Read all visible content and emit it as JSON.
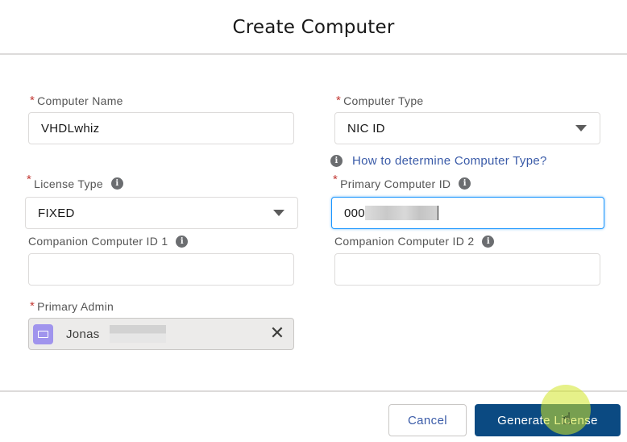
{
  "dialog": {
    "title": "Create Computer"
  },
  "form": {
    "computer_name": {
      "label": "Computer Name",
      "required": "*",
      "value": "VHDLwhiz"
    },
    "computer_type": {
      "label": "Computer Type",
      "required": "*",
      "value": "NIC ID"
    },
    "help_link": {
      "label": "How to determine Computer Type?",
      "icon": "info-icon"
    },
    "license_type": {
      "label": "License Type",
      "required": "*",
      "value": "FIXED",
      "icon": "info-icon"
    },
    "primary_computer_id": {
      "label": "Primary Computer ID",
      "required": "*",
      "value": "000",
      "value_redacted": true,
      "icon": "info-icon"
    },
    "companion_computer_id_1": {
      "label": "Companion Computer ID 1",
      "value": "",
      "icon": "info-icon"
    },
    "companion_computer_id_2": {
      "label": "Companion Computer ID 2",
      "value": "",
      "icon": "info-icon"
    },
    "primary_admin": {
      "label": "Primary Admin",
      "required": "*",
      "value": "Jonas",
      "value_redacted": true,
      "icon": "contact-icon",
      "remove_icon": "close-icon"
    }
  },
  "footer": {
    "cancel_label": "Cancel",
    "generate_label": "Generate License"
  },
  "colors": {
    "primary_button": "#0b4a82",
    "link": "#3a5ba8",
    "required": "#c23934",
    "focus_border": "#1b96ff",
    "contact_icon": "#a094ed"
  },
  "info_glyph": "i",
  "close_glyph": "✕",
  "hand_glyph": "☝"
}
